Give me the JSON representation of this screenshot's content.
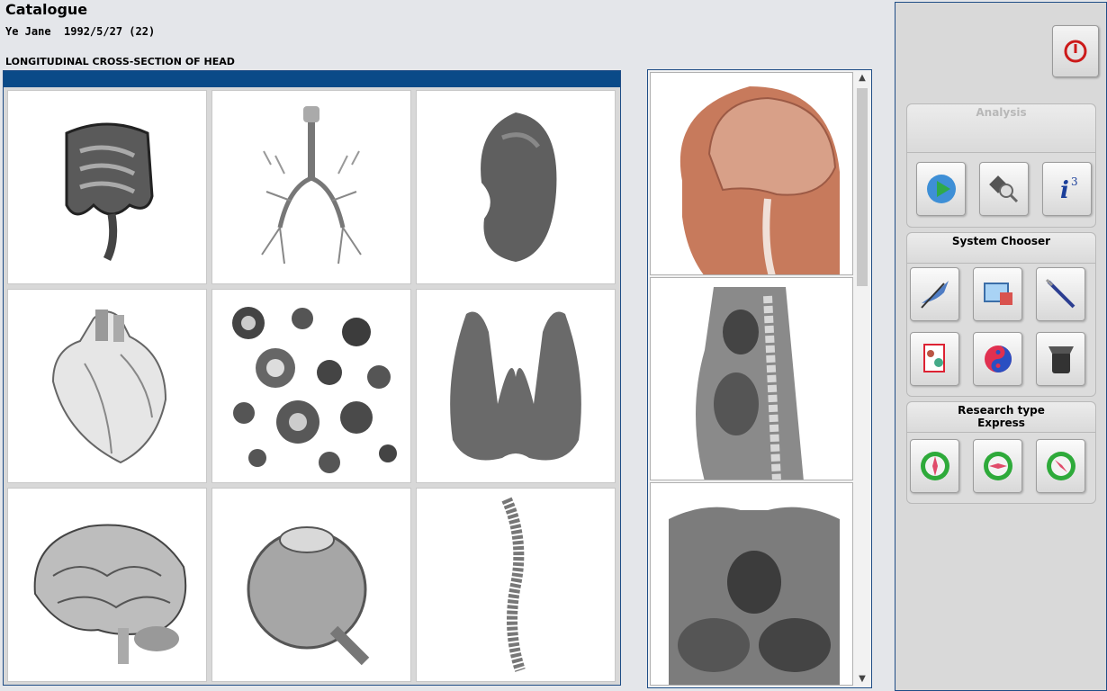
{
  "header": {
    "title": "Catalogue",
    "patient": "Ye Jane  1992/5/27 (22)",
    "section": "LONGITUDINAL CROSS-SECTION OF HEAD"
  },
  "organs": [
    {
      "name": "intestines",
      "icon": "intestines-image"
    },
    {
      "name": "lungs",
      "icon": "bronchi-image"
    },
    {
      "name": "kidney",
      "icon": "kidney-image"
    },
    {
      "name": "heart",
      "icon": "heart-image"
    },
    {
      "name": "blood cells",
      "icon": "blood-cells-image"
    },
    {
      "name": "thyroid",
      "icon": "thyroid-image"
    },
    {
      "name": "brain",
      "icon": "brain-image"
    },
    {
      "name": "eye",
      "icon": "eye-image"
    },
    {
      "name": "spine",
      "icon": "spine-image"
    }
  ],
  "strip": [
    {
      "icon": "head-cross-section-image"
    },
    {
      "icon": "torso-sagittal-image"
    },
    {
      "icon": "torso-coronal-image"
    }
  ],
  "controls": {
    "analysis_label": "Analysis",
    "system_chooser_label": "System Chooser",
    "research_type_label": "Research type",
    "research_type_value": "Express",
    "colors": {
      "power": "#cc1a1a",
      "play": "#2fa94a",
      "panel_border": "#1f4d86",
      "grid_bar": "#0a4a88"
    }
  }
}
